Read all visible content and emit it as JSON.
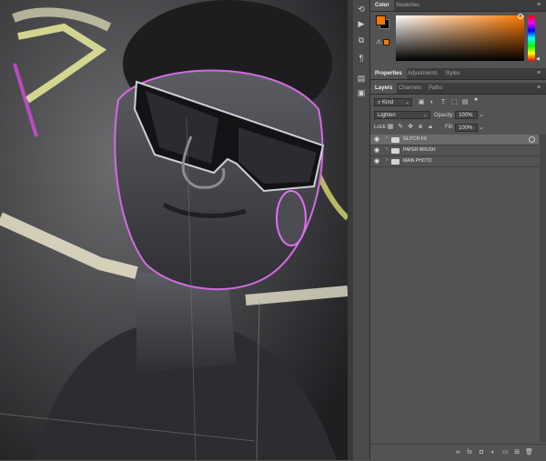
{
  "color_panel": {
    "tabs": [
      {
        "label": "Color"
      },
      {
        "label": "Swatches"
      }
    ],
    "foreground_color": "#ff7700",
    "background_color": "#000000"
  },
  "props_panel": {
    "tabs": [
      {
        "label": "Properties"
      },
      {
        "label": "Adjustments"
      },
      {
        "label": "Styles"
      }
    ]
  },
  "layers_panel": {
    "tabs": [
      {
        "label": "Layers"
      },
      {
        "label": "Channels"
      },
      {
        "label": "Paths"
      }
    ],
    "filter_kind": "Kind",
    "blend_mode": "Lighten",
    "opacity_label": "Opacity:",
    "opacity_value": "100%",
    "lock_label": "Lock:",
    "fill_label": "Fill:",
    "fill_value": "100%",
    "layers": [
      {
        "name": "GLITCH FX"
      },
      {
        "name": "PAPER BRUSH"
      },
      {
        "name": "MAIN PHOTO"
      }
    ],
    "bottom_icons": [
      "link-icon",
      "fx-icon",
      "mask-icon",
      "adjustment-icon",
      "folder-icon",
      "new-layer-icon",
      "trash-icon"
    ]
  },
  "tool_icons": [
    "history-icon",
    "play-icon",
    "clone-source-icon",
    "paragraph-icon",
    "artboard-icon",
    "layers-comp-icon"
  ]
}
